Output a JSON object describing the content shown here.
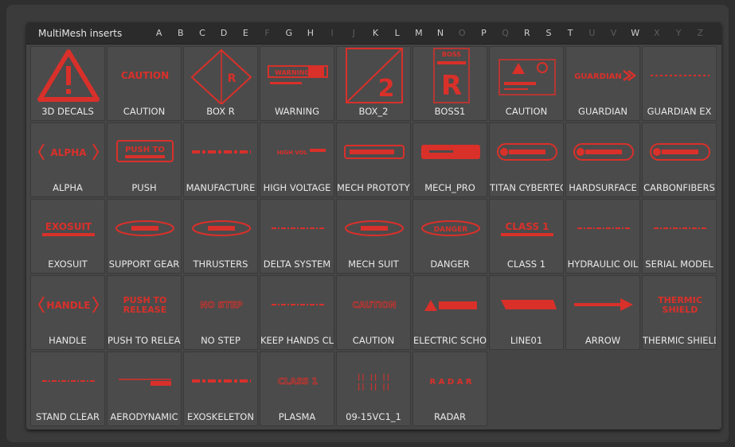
{
  "panel": {
    "title": "MultiMesh inserts",
    "letters": [
      {
        "ch": "A",
        "on": true
      },
      {
        "ch": "B",
        "on": true
      },
      {
        "ch": "C",
        "on": true
      },
      {
        "ch": "D",
        "on": true
      },
      {
        "ch": "E",
        "on": true
      },
      {
        "ch": "F",
        "on": false
      },
      {
        "ch": "G",
        "on": true
      },
      {
        "ch": "H",
        "on": true
      },
      {
        "ch": "I",
        "on": false
      },
      {
        "ch": "J",
        "on": false
      },
      {
        "ch": "K",
        "on": true
      },
      {
        "ch": "L",
        "on": true
      },
      {
        "ch": "M",
        "on": true
      },
      {
        "ch": "N",
        "on": true
      },
      {
        "ch": "O",
        "on": false
      },
      {
        "ch": "P",
        "on": true
      },
      {
        "ch": "Q",
        "on": false
      },
      {
        "ch": "R",
        "on": true
      },
      {
        "ch": "S",
        "on": true
      },
      {
        "ch": "T",
        "on": true
      },
      {
        "ch": "U",
        "on": false
      },
      {
        "ch": "V",
        "on": false
      },
      {
        "ch": "W",
        "on": true
      },
      {
        "ch": "X",
        "on": false
      },
      {
        "ch": "Y",
        "on": false
      },
      {
        "ch": "Z",
        "on": false
      }
    ]
  },
  "colors": {
    "accent": "#d9302a",
    "tile": "#4b4b4b",
    "panel": "#454545",
    "header": "#2b2b2b"
  },
  "items": [
    {
      "label": "3D DECALS",
      "art": "triangle-warning-icon",
      "text": ""
    },
    {
      "label": "CAUTION",
      "art": "text-decal",
      "text": "CAUTION"
    },
    {
      "label": "BOX R",
      "art": "diamond-box-icon",
      "text": "R"
    },
    {
      "label": "WARNING",
      "art": "banner-decal",
      "text": "WARNING"
    },
    {
      "label": "BOX_2",
      "art": "box-two-icon",
      "text": "2"
    },
    {
      "label": "BOSS1",
      "art": "boss-r-icon",
      "text": "BOSS"
    },
    {
      "label": "CAUTION",
      "art": "caution-panel-icon",
      "text": ""
    },
    {
      "label": "GUARDIAN",
      "art": "arrow-text-decal",
      "text": "GUARDIAN"
    },
    {
      "label": "GUARDIAN EX",
      "art": "dotted-line-decal",
      "text": ""
    },
    {
      "label": "ALPHA",
      "art": "bracket-text-decal",
      "text": "ALPHA"
    },
    {
      "label": "PUSH",
      "art": "boxed-text-decal",
      "text": "PUSH TO"
    },
    {
      "label": "MANUFACTURE",
      "art": "dashed-strip-decal",
      "text": ""
    },
    {
      "label": "HIGH VOLTAGE",
      "art": "small-text-decal",
      "text": "HIGH VOL"
    },
    {
      "label": "MECH PROTOTYPE",
      "art": "bar-decal",
      "text": ""
    },
    {
      "label": "MECH_PRO",
      "art": "solid-bar-decal",
      "text": ""
    },
    {
      "label": "TITAN CYBERTEC",
      "art": "pill-decal",
      "text": ""
    },
    {
      "label": "HARDSURFACE",
      "art": "pill-decal",
      "text": ""
    },
    {
      "label": "CARBONFIBERS",
      "art": "pill-decal",
      "text": ""
    },
    {
      "label": "EXOSUIT",
      "art": "stacked-text-decal",
      "text": "EXOSUIT"
    },
    {
      "label": "SUPPORT GEAR",
      "art": "oval-decal",
      "text": ""
    },
    {
      "label": "THRUSTERS",
      "art": "oval-decal",
      "text": ""
    },
    {
      "label": "DELTA SYSTEM",
      "art": "thin-line-decal",
      "text": ""
    },
    {
      "label": "MECH SUIT",
      "art": "oval-decal",
      "text": ""
    },
    {
      "label": "DANGER",
      "art": "oval-text-decal",
      "text": "DANGER"
    },
    {
      "label": "CLASS 1",
      "art": "stacked-text-decal",
      "text": "CLASS 1"
    },
    {
      "label": "HYDRAULIC OIL",
      "art": "thin-line-decal",
      "text": ""
    },
    {
      "label": "SERIAL MODEL",
      "art": "thin-line-decal",
      "text": ""
    },
    {
      "label": "HANDLE",
      "art": "bracket-text-decal",
      "text": "HANDLE"
    },
    {
      "label": "PUSH TO RELEASE",
      "art": "two-line-text-decal",
      "text": "PUSH TO|RELEASE"
    },
    {
      "label": "NO STEP",
      "art": "outline-text-decal",
      "text": "NO STEP"
    },
    {
      "label": "KEEP HANDS CLEAR",
      "art": "thin-line-decal",
      "text": ""
    },
    {
      "label": "CAUTION",
      "art": "outline-text-decal",
      "text": "CAUTION"
    },
    {
      "label": "ELECTRIC SCHOCK",
      "art": "electric-decal",
      "text": ""
    },
    {
      "label": "LINE01",
      "art": "slant-line-icon",
      "text": ""
    },
    {
      "label": "ARROW",
      "art": "arrow-icon",
      "text": ""
    },
    {
      "label": "THERMIC SHIELD",
      "art": "two-line-text-decal",
      "text": "THERMIC|SHIELD"
    },
    {
      "label": "STAND CLEAR",
      "art": "thin-line-decal",
      "text": ""
    },
    {
      "label": "AERODYNAMIC",
      "art": "aero-decal",
      "text": ""
    },
    {
      "label": "EXOSKELETON",
      "art": "dashed-strip-decal",
      "text": ""
    },
    {
      "label": "PLASMA",
      "art": "outline-text-decal",
      "text": "CLASS 1"
    },
    {
      "label": "09-15VC1_1",
      "art": "glyph-decal",
      "text": ""
    },
    {
      "label": "RADAR",
      "art": "spaced-text-decal",
      "text": "R A D A R"
    }
  ]
}
